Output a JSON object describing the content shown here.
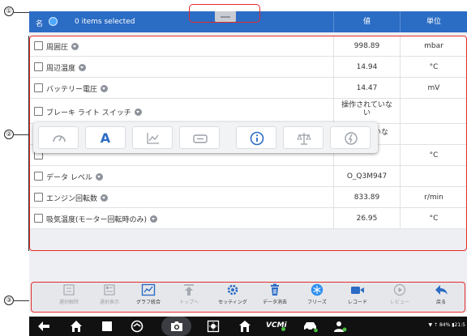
{
  "callouts": [
    "①",
    "②",
    "③"
  ],
  "header": {
    "name_col": "名",
    "selected_text": "0 items selected",
    "value_col": "値",
    "unit_col": "単位"
  },
  "rows": [
    {
      "name": "周囲圧",
      "value": "998.89",
      "unit": "mbar"
    },
    {
      "name": "周辺温度",
      "value": "14.94",
      "unit": "°C"
    },
    {
      "name": "バッテリー電圧",
      "value": "14.47",
      "unit": "mV"
    },
    {
      "name": "ブレーキ ライト スイッチ",
      "value": "操作されていな\nい",
      "unit": ""
    },
    {
      "name": "",
      "value": "いな",
      "unit": ""
    },
    {
      "name": "",
      "value": "",
      "unit": "°C"
    },
    {
      "name": "データ レベル",
      "value": "O_Q3M947",
      "unit": ""
    },
    {
      "name": "エンジン回転数",
      "value": "833.89",
      "unit": "r/min"
    },
    {
      "name": "吸気温度(モーター回転時のみ)",
      "value": "26.95",
      "unit": "°C"
    }
  ],
  "popup": {
    "icons": [
      "gauge-icon",
      "text-display-icon",
      "line-graph-icon",
      "digital-display-icon",
      "info-icon",
      "scale-icon",
      "speedometer-icon"
    ],
    "text_label": "A"
  },
  "toolbar": {
    "items": [
      {
        "label": "選択解除",
        "icon": "deselect-icon",
        "enabled": false
      },
      {
        "label": "選択表示",
        "icon": "show-selected-icon",
        "enabled": false
      },
      {
        "label": "グラフ統合",
        "icon": "merge-graph-icon",
        "enabled": true
      },
      {
        "label": "トップへ",
        "icon": "to-top-icon",
        "enabled": false
      },
      {
        "label": "セッティング",
        "icon": "settings-icon",
        "enabled": true
      },
      {
        "label": "データ消去",
        "icon": "trash-icon",
        "enabled": true
      },
      {
        "label": "フリーズ",
        "icon": "freeze-icon",
        "enabled": true
      },
      {
        "label": "レコード",
        "icon": "record-icon",
        "enabled": true
      },
      {
        "label": "レビュー",
        "icon": "review-icon",
        "enabled": false
      },
      {
        "label": "戻る",
        "icon": "back-arrow-icon",
        "enabled": true
      }
    ]
  },
  "navbar": {
    "status": "84%",
    "vcm_label": "VCMi"
  },
  "colors": {
    "accent": "#2b6cc4",
    "callout": "#e32b2b"
  }
}
